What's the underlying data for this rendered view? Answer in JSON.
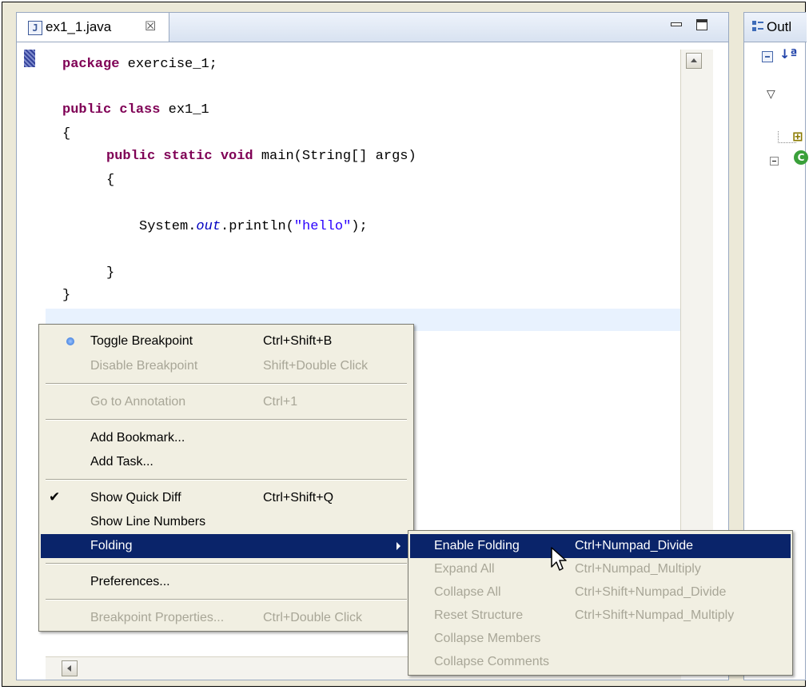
{
  "editor": {
    "tab_label": "ex1_1.java",
    "tab_close_glyph": "☒",
    "tab_file_glyph": "J"
  },
  "code": {
    "line1_kw": "package",
    "line1_rest": " exercise_1;",
    "line2_kw": "public class",
    "line2_rest": " ex1_1",
    "line3": "{",
    "line4_kw": "public static void",
    "line4_rest": " main(String[] args)",
    "line5": "{",
    "line6_a": "System.",
    "line6_field": "out",
    "line6_b": ".println(",
    "line6_str": "\"hello\"",
    "line6_c": ");",
    "line7": "}",
    "line8": "}"
  },
  "outline": {
    "tab_label": "Outl",
    "sort_glyph": "↓ª",
    "view_menu_glyph": "▽",
    "package_glyph": "⊞",
    "class_glyph": "C"
  },
  "context_menu": {
    "toggle_breakpoint": "Toggle Breakpoint",
    "toggle_breakpoint_sc": "Ctrl+Shift+B",
    "disable_breakpoint": "Disable Breakpoint",
    "disable_breakpoint_sc": "Shift+Double Click",
    "go_to_annotation": "Go to Annotation",
    "go_to_annotation_sc": "Ctrl+1",
    "add_bookmark": "Add Bookmark...",
    "add_task": "Add Task...",
    "show_quick_diff": "Show Quick Diff",
    "show_quick_diff_sc": "Ctrl+Shift+Q",
    "check_glyph": "✔",
    "show_line_numbers": "Show Line Numbers",
    "folding": "Folding",
    "preferences": "Preferences...",
    "breakpoint_properties": "Breakpoint Properties...",
    "breakpoint_properties_sc": "Ctrl+Double Click"
  },
  "folding_menu": {
    "enable_folding": "Enable Folding",
    "enable_folding_sc": "Ctrl+Numpad_Divide",
    "expand_all": "Expand All",
    "expand_all_sc": "Ctrl+Numpad_Multiply",
    "collapse_all": "Collapse All",
    "collapse_all_sc": "Ctrl+Shift+Numpad_Divide",
    "reset_structure": "Reset Structure",
    "reset_structure_sc": "Ctrl+Shift+Numpad_Multiply",
    "collapse_members": "Collapse Members",
    "collapse_comments": "Collapse Comments"
  },
  "colors": {
    "menu_highlight": "#0a246a",
    "keyword": "#7f0055",
    "string": "#2a00ff",
    "field": "#0000c0",
    "current_line": "#e8f2fe"
  }
}
